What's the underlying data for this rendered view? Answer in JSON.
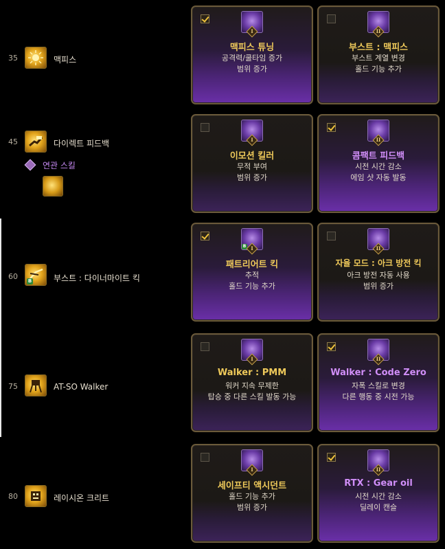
{
  "colors": {
    "accent_gold": "#eec95a",
    "accent_purple": "#d08ef8",
    "related_text": "#c488f0",
    "check": "#f0c33c"
  },
  "rows": [
    {
      "level": "35",
      "skill": "맥피스",
      "icon": "sun-burst-icon",
      "options": [
        {
          "tier": "I",
          "checked": true,
          "title": "맥피스 튜닝",
          "lines": [
            "공격력/쿨타임 증가",
            "범위 증가"
          ]
        },
        {
          "tier": "II",
          "checked": false,
          "title": "부스트 : 맥피스",
          "lines": [
            "부스트 계열 변경",
            "홀드 기능 추가"
          ]
        }
      ]
    },
    {
      "level": "45",
      "skill": "다이렉트 피드백",
      "icon": "mech-arm-icon",
      "related": {
        "tier": "II",
        "label": "연관 스킬"
      },
      "options": [
        {
          "tier": "I",
          "checked": false,
          "title": "이모션 킬러",
          "lines": [
            "무적 부여",
            "범위 증가"
          ]
        },
        {
          "tier": "II",
          "checked": true,
          "title": "콤팩트 피드백",
          "lines": [
            "시전 시간 감소",
            "에임 샷 자동 발동"
          ]
        }
      ]
    },
    {
      "level": "60",
      "skill": "부스트 : 다이너마이트 킥",
      "icon": "kick-icon",
      "badge": "B",
      "options": [
        {
          "tier": "I",
          "checked": true,
          "title": "패트리어트 킥",
          "lines": [
            "추적",
            "홀드 기능 추가"
          ]
        },
        {
          "tier": "II",
          "checked": false,
          "title": "자율 모드 : 아크 방전 킥",
          "lines": [
            "아크 방전 자동 사용",
            "범위 증가"
          ]
        }
      ]
    },
    {
      "level": "75",
      "skill": "AT-SO Walker",
      "icon": "walker-icon",
      "options": [
        {
          "tier": "I",
          "checked": false,
          "title": "Walker : PMM",
          "lines": [
            "워커 지속 무제한",
            "탑승 중 다른 스킬 발동 가능"
          ]
        },
        {
          "tier": "II",
          "checked": true,
          "title": "Walker : Code Zero",
          "lines": [
            "자폭 스킬로 변경",
            "다른 행동 중 시전 가능"
          ]
        }
      ]
    },
    {
      "level": "80",
      "skill": "레이시온 크리트",
      "icon": "robot-icon",
      "options": [
        {
          "tier": "I",
          "checked": false,
          "title": "세이프티 액시던트",
          "lines": [
            "홀드 기능 추가",
            "범위 증가"
          ]
        },
        {
          "tier": "II",
          "checked": true,
          "title": "RTX : Gear oil",
          "lines": [
            "시전 시간 감소",
            "딜레이 캔슬"
          ]
        }
      ]
    }
  ]
}
